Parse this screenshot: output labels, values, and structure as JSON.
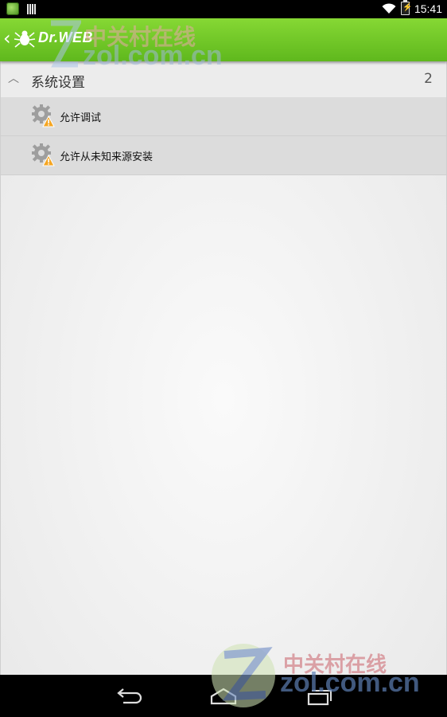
{
  "status_bar": {
    "time": "15:41"
  },
  "action_bar": {
    "title": "Dr.WEB"
  },
  "group": {
    "title": "系统设置",
    "count": "2"
  },
  "items": [
    {
      "label": "允许调试",
      "icon": "gear-warning-icon"
    },
    {
      "label": "允许从未知来源安装",
      "icon": "gear-warning-icon"
    }
  ],
  "watermark": {
    "cn": "中关村在线",
    "en": "zol.com.cn"
  },
  "colors": {
    "accent": "#6fc828",
    "warning": "#f5a623"
  }
}
